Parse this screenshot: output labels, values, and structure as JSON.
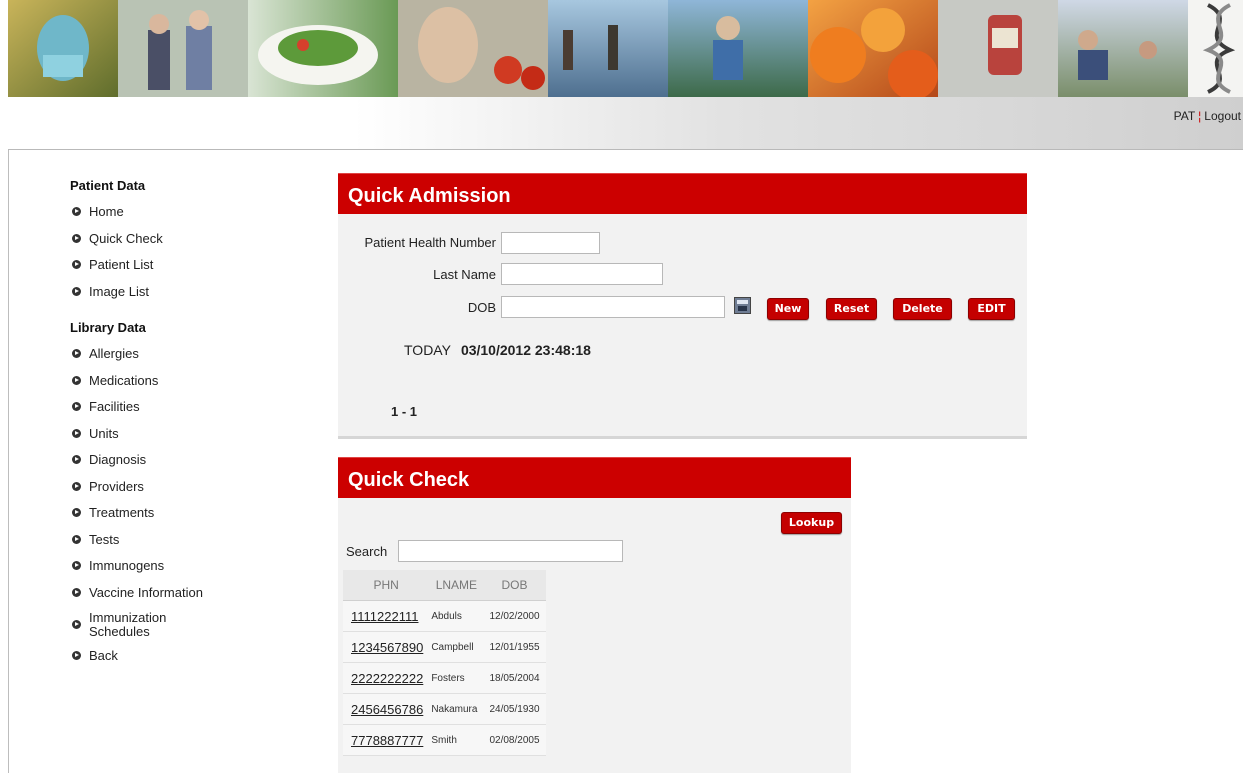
{
  "header": {
    "user_label": "PAT",
    "separator": "¦",
    "logout_label": "Logout"
  },
  "sidebar": {
    "patient_heading": "Patient Data",
    "patient_items": [
      {
        "label": "Home"
      },
      {
        "label": "Quick Check"
      },
      {
        "label": "Patient List"
      },
      {
        "label": "Image List"
      }
    ],
    "library_heading": "Library Data",
    "library_items": [
      {
        "label": "Allergies"
      },
      {
        "label": "Medications"
      },
      {
        "label": "Facilities"
      },
      {
        "label": "Units"
      },
      {
        "label": "Diagnosis"
      },
      {
        "label": "Providers"
      },
      {
        "label": "Treatments"
      },
      {
        "label": "Tests"
      },
      {
        "label": "Immunogens"
      },
      {
        "label": "Vaccine Information"
      },
      {
        "label_line1": "Immunization",
        "label_line2": "Schedules"
      },
      {
        "label": "Back"
      }
    ]
  },
  "quick_admission": {
    "title": "Quick Admission",
    "phn_label": "Patient Health Number",
    "phn_value": "",
    "lastname_label": "Last Name",
    "lastname_value": "",
    "dob_label": "DOB",
    "dob_value": "",
    "buttons": {
      "new": "New",
      "reset": "Reset",
      "delete": "Delete",
      "edit": "EDIT"
    },
    "today_label": "TODAY",
    "today_value": "03/10/2012 23:48:18",
    "range": "1 - 1"
  },
  "quick_check": {
    "title": "Quick Check",
    "lookup_label": "Lookup",
    "search_label": "Search",
    "search_value": "",
    "columns": [
      "PHN",
      "LNAME",
      "DOB"
    ],
    "rows": [
      {
        "phn": "1111222111",
        "lname": "Abduls",
        "dob": "12/02/2000"
      },
      {
        "phn": "1234567890",
        "lname": "Campbell",
        "dob": "12/01/1955"
      },
      {
        "phn": "2222222222",
        "lname": "Fosters",
        "dob": "18/05/2004"
      },
      {
        "phn": "2456456786",
        "lname": "Nakamura",
        "dob": "24/05/1930"
      },
      {
        "phn": "7778887777",
        "lname": "Smith",
        "dob": "02/08/2005"
      }
    ]
  },
  "colors": {
    "accent_red": "#cc0000",
    "panel_bg": "#f2f2f2"
  }
}
